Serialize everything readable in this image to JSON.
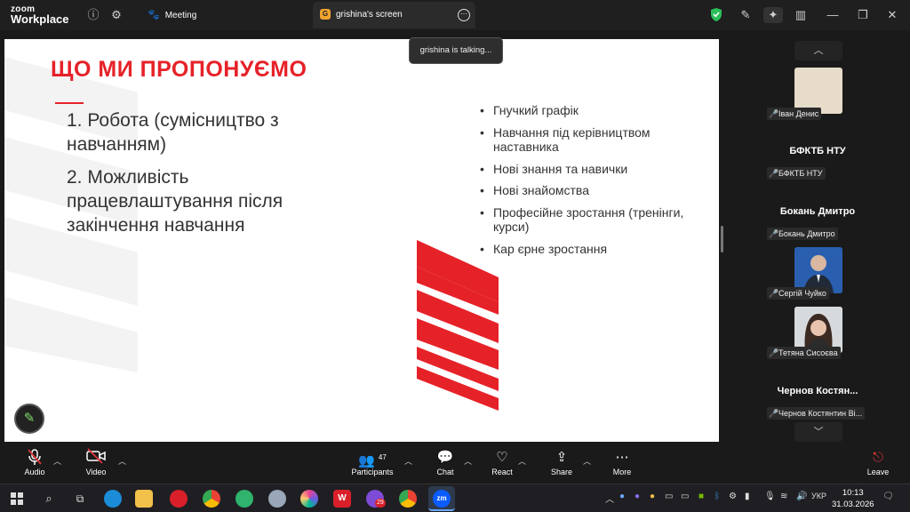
{
  "titlebar": {
    "logo_line1": "zoom",
    "logo_line2": "Workplace",
    "tabs": [
      {
        "label": "Meeting"
      },
      {
        "label": "grishina's screen",
        "badge": "G"
      }
    ]
  },
  "tooltip": {
    "text": "grishina is talking..."
  },
  "slide": {
    "title": "ЩО МИ ПРОПОНУЄМО",
    "left_items": [
      "1. Робота (сумісництво з навчанням)",
      "2. Можливість працевлаштування після закінчення навчання"
    ],
    "bullets": [
      "Гнучкий графік",
      "Навчання під керівництвом наставника",
      "Нові знання та навички",
      "Нові знайомства",
      "Професійне зростання (тренінги, курси)",
      "Кар єрне зростання"
    ]
  },
  "participants": [
    {
      "big_name": "",
      "tag": "Іван Денис",
      "has_photo": true
    },
    {
      "big_name": "БФКТБ НТУ",
      "tag": "БФКТБ НТУ",
      "has_photo": false
    },
    {
      "big_name": "Бокань Дмитро",
      "tag": "Бокань Дмитро",
      "has_photo": false
    },
    {
      "big_name": "",
      "tag": "Сергій Чуйко",
      "has_photo": true
    },
    {
      "big_name": "",
      "tag": "Тетяна Сисоєва",
      "has_photo": true
    },
    {
      "big_name": "Чернов Костян...",
      "tag": "Чернов Костянтин Ві...",
      "has_photo": false
    }
  ],
  "toolbar": {
    "audio": "Audio",
    "video": "Video",
    "participants": "Participants",
    "participants_count": "47",
    "chat": "Chat",
    "react": "React",
    "share": "Share",
    "more": "More",
    "leave": "Leave"
  },
  "taskbar": {
    "viber_badge": "29",
    "lang": "УКР",
    "time": "10:13",
    "date": "31.03.2026"
  },
  "colors": {
    "accent_red": "#e62229",
    "zoom_blue": "#0b5cff",
    "shield_green": "#2bbf5a"
  }
}
